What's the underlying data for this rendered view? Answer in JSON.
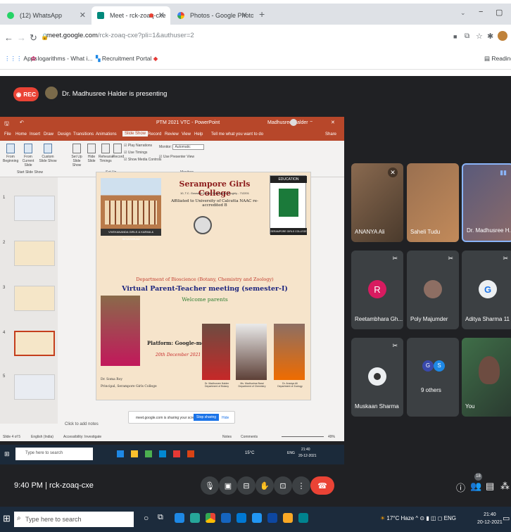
{
  "browser": {
    "tabs": [
      {
        "title": "(12) WhatsApp",
        "color": "#25d366"
      },
      {
        "title": "Meet - rck-zoaq-cxe",
        "color": "#00897b",
        "recording": true
      },
      {
        "title": "Photos - Google Photos",
        "color": "#fbbc04"
      }
    ],
    "new_tab": "+",
    "url_host": "meet.google.com",
    "url_path": "/rck-zoaq-cxe?pli=1&authuser=2",
    "bookmarks": [
      "Apps",
      "logarithms - What i...",
      "Recruitment Portal"
    ],
    "reading_list": "Reading l"
  },
  "meet": {
    "rec_label": "REC",
    "presenting": "Dr. Madhusree Halder is presenting",
    "time": "9:40 PM",
    "separator": "|",
    "code": "rck-zoaq-cxe",
    "participant_count": "18"
  },
  "ppt": {
    "window_title": "PTM 2021 VTC - PowerPoint",
    "user": "Madhusree Halder",
    "menu": [
      "File",
      "Home",
      "Insert",
      "Draw",
      "Design",
      "Transitions",
      "Animations",
      "Slide Show",
      "Record",
      "Review",
      "View",
      "Help",
      "Tell me what you want to do"
    ],
    "share": "Share",
    "ribbon": {
      "from_beginning": "From Beginning",
      "from_current": "From Current Slide",
      "custom": "Custom Slide Show",
      "setup": "Set Up Slide Show",
      "hide": "Hide Slide",
      "rehearse": "Rehearse Timings",
      "record": "Record",
      "play_narr": "Play Narrations",
      "use_timings": "Use Timings",
      "show_media": "Show Media Controls",
      "monitor": "Monitor:",
      "monitor_val": "Automatic",
      "presenter_view": "Use Presenter View",
      "grp1": "Start Slide Show",
      "grp2": "Set Up",
      "grp3": "Monitors"
    },
    "thumb_numbers": [
      "1",
      "2",
      "3",
      "4",
      "5"
    ],
    "status_left": "Slide 4 of 5",
    "status_lang": "English (India)",
    "status_access": "Accessibility: Investigate",
    "status_notes": "Notes",
    "status_comments": "Comments",
    "zoom": "49%",
    "add_notes": "Click to add notes",
    "share_banner": "meet.google.com is sharing your screen.",
    "stop_sharing": "Stop sharing",
    "hide": "Hide",
    "inner_search": "Type here to search",
    "inner_temp": "15°C",
    "inner_lang": "ENG",
    "inner_time": "21:40",
    "inner_date": "20-12-2021"
  },
  "slide": {
    "college": "Serampore Girls College",
    "address": "10, T.C. Goswami Street, Serampore Hooghly - 712201",
    "affiliation": "Affiliated to University of Calcutta NAAC re-accredited B",
    "photo_caption": "VIVEKANANDA GIRLS & KARMA & SEVASHRAM",
    "logo_top": "EDUCATION",
    "logo_left": "ENLIGHTENMENT",
    "logo_right": "EMPOWERMENT",
    "logo_bottom": "SERAMPORE GIRLS COLLEGE",
    "dept": "Department of Bioscience (Botany, Chemistry and Zoology)",
    "meeting": "Virtual Parent-Teacher meeting (semester-I)",
    "welcome": "Welcome parents",
    "platform": "Platform: Google-meet",
    "date": "20th December 2021",
    "principal_name": "Dr. Soma Roy",
    "principal_title": "Principal, Serampore Girls College",
    "people": [
      {
        "name": "Dr. Madhusree Halder",
        "dept": "Department of Botany"
      },
      {
        "name": "Ms. Madhurima Barai",
        "dept": "Department of Chemistry"
      },
      {
        "name": "Dr. Ananya Ali",
        "dept": "Department of Zoology"
      }
    ]
  },
  "participants": [
    {
      "name": "ANANYA Ali",
      "type": "video",
      "bg": "#6b4e3a"
    },
    {
      "name": "Saheli Tudu",
      "type": "video",
      "bg": "#7a5a3c"
    },
    {
      "name": "Dr. Madhusree H...",
      "type": "video",
      "bg": "#4a4a6a",
      "speaking": true
    },
    {
      "name": "Reetambhara Gh...",
      "type": "avatar",
      "letter": "R",
      "avatar_color": "#d81b60"
    },
    {
      "name": "Poly Majumder",
      "type": "photo",
      "avatar_color": "#8d6e63"
    },
    {
      "name": "Aditya Sharma 11 ...",
      "type": "photo",
      "avatar_color": "#546e7a"
    },
    {
      "name": "Muskaan Sharma",
      "type": "photo",
      "avatar_color": "#37474f"
    },
    {
      "name": "9 others",
      "type": "others",
      "letters": [
        "G",
        "S"
      ]
    },
    {
      "name": "You",
      "type": "video",
      "bg": "#2e5d3a"
    }
  ],
  "taskbar": {
    "search": "Type here to search",
    "weather": "17°C Haze",
    "lang": "ENG",
    "time": "21:40",
    "date": "20-12-2021"
  },
  "icons": [
    "windows-icon",
    "search-icon",
    "mic-icon",
    "camera-icon",
    "captions-icon",
    "raise-hand-icon",
    "present-icon",
    "more-icon",
    "end-call-icon",
    "info-icon",
    "people-icon",
    "chat-icon",
    "activities-icon"
  ]
}
